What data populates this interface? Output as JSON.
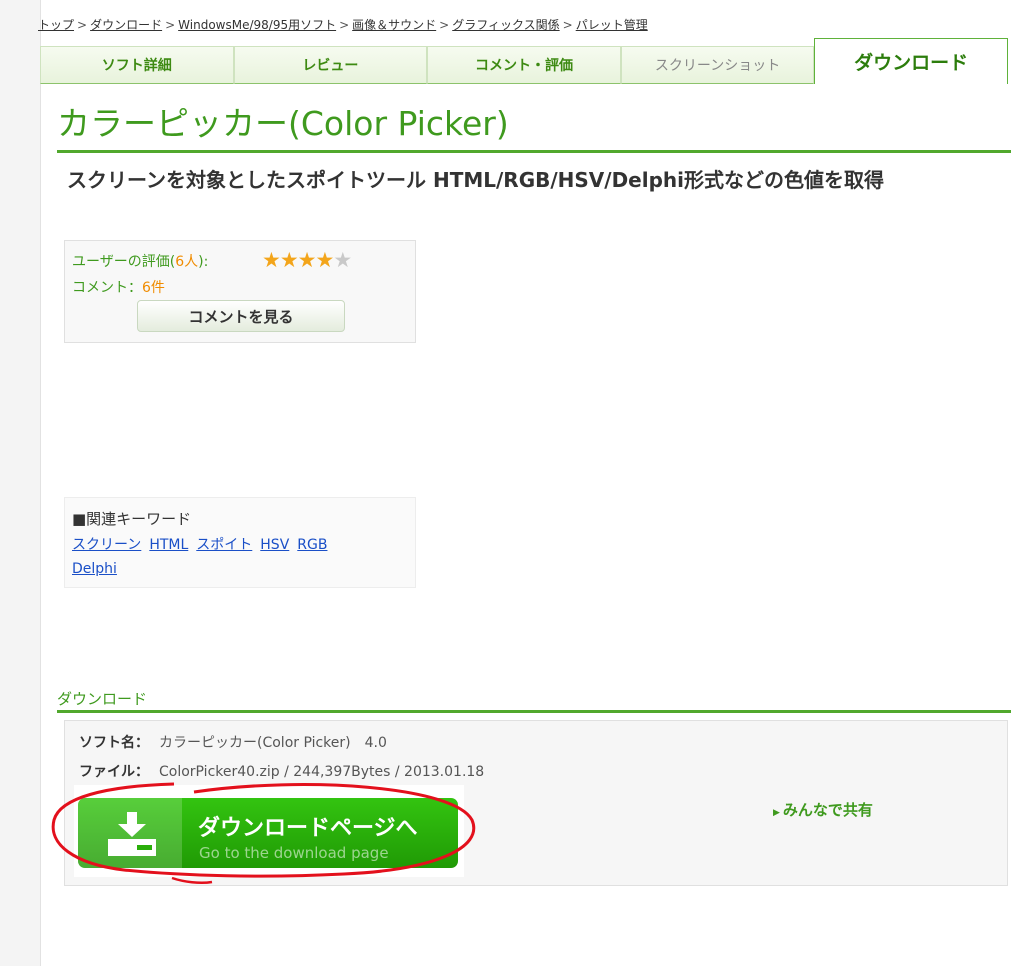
{
  "breadcrumb": [
    "トップ",
    "ダウンロード",
    "WindowsMe/98/95用ソフト",
    "画像＆サウンド",
    "グラフィックス関係",
    "パレット管理"
  ],
  "breadcrumb_sep": ">",
  "tabs": [
    "ソフト詳細",
    "レビュー",
    "コメント・評価",
    "スクリーンショット",
    "ダウンロード"
  ],
  "title": "カラーピッカー(Color Picker)",
  "subtitle": "スクリーンを対象としたスポイトツール HTML/RGB/HSV/Delphi形式などの色値を取得",
  "rating": {
    "label_prefix": "ユーザーの評価(",
    "count": "6人",
    "label_suffix": "):",
    "stars": "★★★★",
    "half_star": "★",
    "score": 4.5,
    "comment_prefix": "コメント：",
    "comment_count": "6件",
    "view_button": "コメントを見る"
  },
  "keywords": {
    "title": "■関連キーワード",
    "links": [
      "スクリーン",
      "HTML",
      "スポイト",
      "HSV",
      "RGB",
      "Delphi"
    ]
  },
  "download": {
    "heading": "ダウンロード",
    "soft_label": "ソフト名：",
    "soft_value": "カラーピッカー(Color Picker)　4.0",
    "file_label": "ファイル：",
    "file_value": "ColorPicker40.zip / 244,397Bytes / 2013.01.18",
    "button_main": "ダウンロードページへ",
    "button_sub": "Go to the download page",
    "share": "みんなで共有"
  },
  "colors": {
    "accent": "#3f9a1e",
    "button": "#2aae0a",
    "annotation": "#e3101c",
    "link": "#1a4fc7"
  }
}
